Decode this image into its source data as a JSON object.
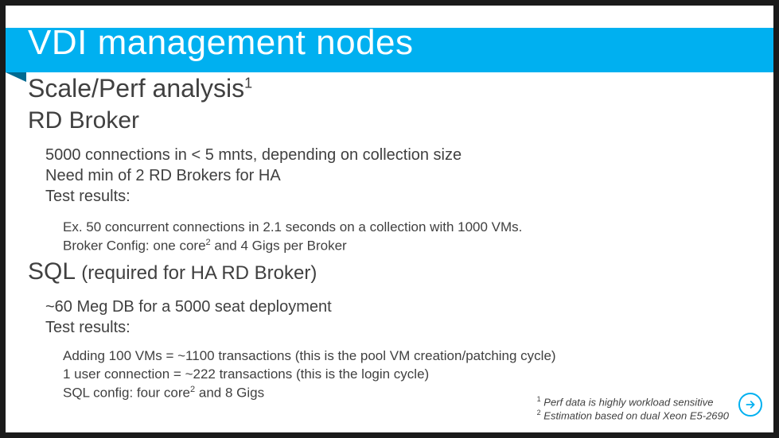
{
  "title": "VDI management nodes",
  "subtitle": {
    "text": "Scale/Perf analysis",
    "sup": "1"
  },
  "section1": {
    "heading": "RD Broker",
    "lines": [
      "5000 connections in < 5 mnts, depending on collection size",
      "Need min of 2 RD Brokers for HA",
      "Test results:"
    ],
    "sub": {
      "line1": "Ex. 50 concurrent connections in 2.1 seconds on a collection with 1000 VMs.",
      "line2a": "Broker Config: one core",
      "line2sup": "2",
      "line2b": " and 4 Gigs per Broker"
    }
  },
  "section2": {
    "heading_main": "SQL ",
    "heading_paren": "(required for HA RD Broker)",
    "lines": [
      "~60 Meg DB for a 5000 seat deployment",
      "Test results:"
    ],
    "sub": {
      "line1": "Adding 100 VMs = ~1100 transactions (this is the pool VM creation/patching cycle)",
      "line2": "1 user connection = ~222 transactions (this is the login cycle)",
      "line3a": "SQL config: four core",
      "line3sup": "2",
      "line3b": " and 8 Gigs"
    }
  },
  "footnotes": {
    "f1sup": "1",
    "f1": " Perf data is highly workload sensitive",
    "f2sup": "2",
    "f2": " Estimation based on dual Xeon E5-2690"
  }
}
